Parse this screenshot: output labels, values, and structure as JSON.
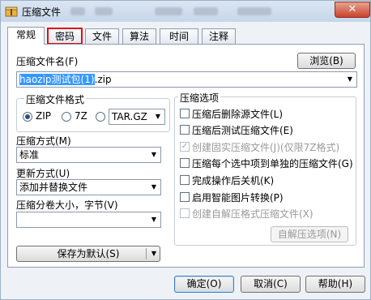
{
  "window": {
    "title": "压缩文件",
    "close_glyph": "✕"
  },
  "tabs": [
    {
      "label": "常规",
      "active": true
    },
    {
      "label": "密码",
      "highlighted": true
    },
    {
      "label": "文件"
    },
    {
      "label": "算法"
    },
    {
      "label": "时间"
    },
    {
      "label": "注释"
    }
  ],
  "archive": {
    "name_label": "压缩文件名(F)",
    "browse_label": "浏览(B)",
    "filename_selected": "haozip测试包(1)",
    "filename_rest": ".zip"
  },
  "format": {
    "group_title": "压缩文件格式",
    "zip": "ZIP",
    "seven_z": "7Z",
    "tar_gz": "TAR.GZ",
    "selected": "ZIP"
  },
  "method": {
    "label": "压缩方式(M)",
    "value": "标准"
  },
  "update": {
    "label": "更新方式(U)",
    "value": "添加并替换文件"
  },
  "split": {
    "label": "压缩分卷大小，字节(V)",
    "value": ""
  },
  "save_default": {
    "label": "保存为默认(S)",
    "menu_glyph": "▼"
  },
  "options": {
    "group_title": "压缩选项",
    "items": [
      {
        "label": "压缩后删除源文件(L)",
        "checked": false,
        "disabled": false
      },
      {
        "label": "压缩后测试压缩文件(E)",
        "checked": false,
        "disabled": false
      },
      {
        "label": "创建固实压缩文件(J)(仅限7Z格式)",
        "checked": true,
        "disabled": true
      },
      {
        "label": "压缩每个选中项到单独的压缩文件(G)",
        "checked": false,
        "disabled": false
      },
      {
        "label": "完成操作后关机(K)",
        "checked": false,
        "disabled": false
      },
      {
        "label": "启用智能图片转换(P)",
        "checked": false,
        "disabled": false
      },
      {
        "label": "创建自解压格式压缩文件(X)",
        "checked": false,
        "disabled": true
      }
    ],
    "sfx_button": "自解压选项(N)"
  },
  "footer": {
    "ok": "确定(O)",
    "cancel": "取消(C)",
    "help": "帮助(H)"
  },
  "colors": {
    "tab_highlight": "#e01010",
    "selection": "#3399ff",
    "accent": "#3c7fb1"
  }
}
